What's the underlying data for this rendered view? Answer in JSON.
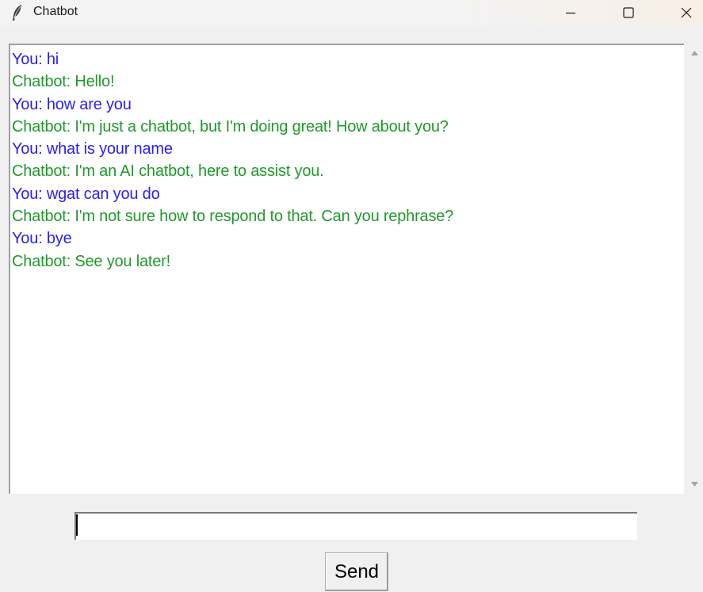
{
  "window": {
    "title": "Chatbot"
  },
  "chat": {
    "messages": [
      {
        "role": "user",
        "text": "You: hi"
      },
      {
        "role": "bot",
        "text": "Chatbot: Hello!"
      },
      {
        "role": "user",
        "text": "You: how are you"
      },
      {
        "role": "bot",
        "text": "Chatbot: I'm just a chatbot, but I'm doing great! How about you?"
      },
      {
        "role": "user",
        "text": "You: what is your name"
      },
      {
        "role": "bot",
        "text": "Chatbot: I'm an AI chatbot, here to assist you."
      },
      {
        "role": "user",
        "text": "You: wgat can you do"
      },
      {
        "role": "bot",
        "text": "Chatbot: I'm not sure how to respond to that. Can you rephrase?"
      },
      {
        "role": "user",
        "text": "You: bye"
      },
      {
        "role": "bot",
        "text": "Chatbot: See you later!"
      }
    ],
    "colors": {
      "user": "#2b1ef0",
      "bot": "#1f9a2a"
    }
  },
  "input": {
    "value": ""
  },
  "send_button": {
    "label": "Send"
  },
  "icons": {
    "app": "feather-icon",
    "minimize": "minimize-icon",
    "maximize": "maximize-icon",
    "close": "close-icon",
    "scroll_up": "scroll-up-arrow-icon",
    "scroll_down": "scroll-down-arrow-icon"
  }
}
